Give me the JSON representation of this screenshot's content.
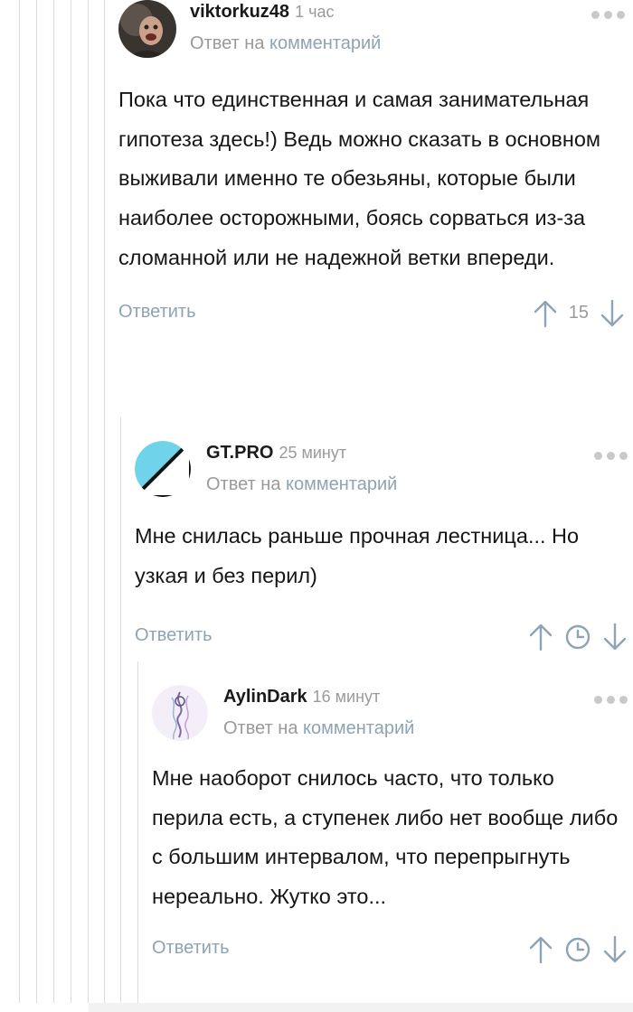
{
  "comments": [
    {
      "username": "viktorkuz48",
      "time": "1 час",
      "reply_prefix": "Ответ на",
      "reply_link": "комментарий",
      "text": "Пока что единственная и самая занимательная гипотеза здесь!) Ведь можно сказать в основном выживали именно те обезьяны, которые были наиболее осторожными, боясь сорваться из-за сломанной или не надежной ветки впереди.",
      "reply_label": "Ответить",
      "score": "15"
    },
    {
      "username": "GT.PRO",
      "time": "25 минут",
      "reply_prefix": "Ответ на",
      "reply_link": "комментарий",
      "text": "Мне снилась раньше прочная лестница... Но узкая и без перил)",
      "reply_label": "Ответить"
    },
    {
      "username": "AylinDark",
      "time": "16 минут",
      "reply_prefix": "Ответ на",
      "reply_link": "комментарий",
      "text": "Мне наоборот снилось часто, что только перила есть, а ступенек либо нет вообще либо с большим интервалом, что перепрыгнуть нереально. Жутко это...",
      "reply_label": "Ответить"
    }
  ],
  "icons": {
    "upvote": "arrow-up-icon",
    "downvote": "arrow-down-icon",
    "score_pending": "clock-icon",
    "more": "more-dots-icon"
  },
  "colors": {
    "link": "#8ea3b3",
    "muted": "#9a9a9a",
    "text": "#161616",
    "thread_line": "#dcdcdc",
    "gtpro_cyan": "#6fd3ea"
  }
}
